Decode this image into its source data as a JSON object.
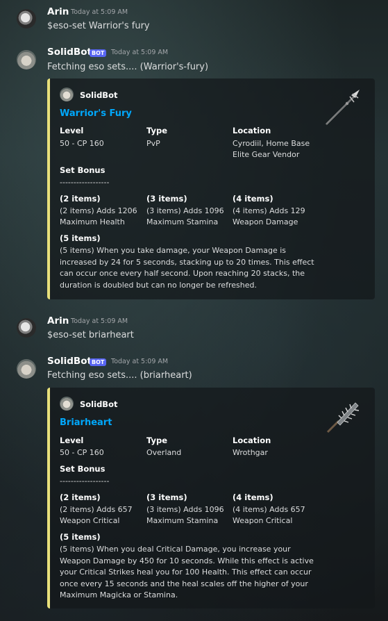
{
  "messages": [
    {
      "author": "Arin",
      "timestamp": "Today at 5:09 AM",
      "text": "$eso-set Warrior's fury"
    },
    {
      "author": "SolidBot",
      "badge": "BOT",
      "timestamp": "Today at 5:09 AM",
      "text": "Fetching eso sets.... (Warrior's-fury)",
      "embed": {
        "author": "SolidBot",
        "title": "Warrior's Fury",
        "level_name": "Level",
        "level_value": "50 - CP 160",
        "type_name": "Type",
        "type_value": "PvP",
        "location_name": "Location",
        "location_value": "Cyrodiil, Home Base\nElite Gear Vendor",
        "set_bonus_name": "Set Bonus",
        "divider": "------------------",
        "b2_name": "(2 items)",
        "b2_value": " (2 items) Adds 1206\nMaximum Health",
        "b3_name": "(3 items)",
        "b3_value": " (3 items) Adds 1096\nMaximum Stamina",
        "b4_name": "(4 items)",
        "b4_value": " (4 items) Adds 129\nWeapon Damage",
        "b5_name": "(5 items)",
        "b5_value": " (5 items) When you take damage, your Weapon Damage is increased by 24 for 5 seconds, stacking up to 20 times. This effect can occur once every half second. Upon reaching 20 stacks, the duration is doubled but can no longer be refreshed.",
        "thumbnail": "spear-weapon-icon"
      }
    },
    {
      "author": "Arin",
      "timestamp": "Today at 5:09 AM",
      "text": "$eso-set briarheart"
    },
    {
      "author": "SolidBot",
      "badge": "BOT",
      "timestamp": "Today at 5:09 AM",
      "text": "Fetching eso sets.... (briarheart)",
      "embed": {
        "author": "SolidBot",
        "title": "Briarheart",
        "level_name": "Level",
        "level_value": "50 - CP 160",
        "type_name": "Type",
        "type_value": "Overland",
        "location_name": "Location",
        "location_value": "Wrothgar",
        "set_bonus_name": "Set Bonus",
        "divider": "------------------",
        "b2_name": "(2 items)",
        "b2_value": " (2 items) Adds 657\nWeapon Critical",
        "b3_name": "(3 items)",
        "b3_value": " (3 items) Adds 1096\nMaximum Stamina",
        "b4_name": "(4 items)",
        "b4_value": " (4 items) Adds 657\nWeapon Critical",
        "b5_name": "(5 items)",
        "b5_value": " (5 items) When you deal Critical Damage, you increase your Weapon Damage by 450 for 10 seconds. While this effect is active your Critical Strikes heal you for 100 Health. This effect can occur once every 15 seconds and the heal scales off the higher of your Maximum Magicka or Stamina.",
        "thumbnail": "spiked-club-icon"
      }
    }
  ],
  "colors": {
    "embed_border": "#e8e07b",
    "embed_title": "#00a8fc",
    "bot_badge": "#5865f2"
  }
}
